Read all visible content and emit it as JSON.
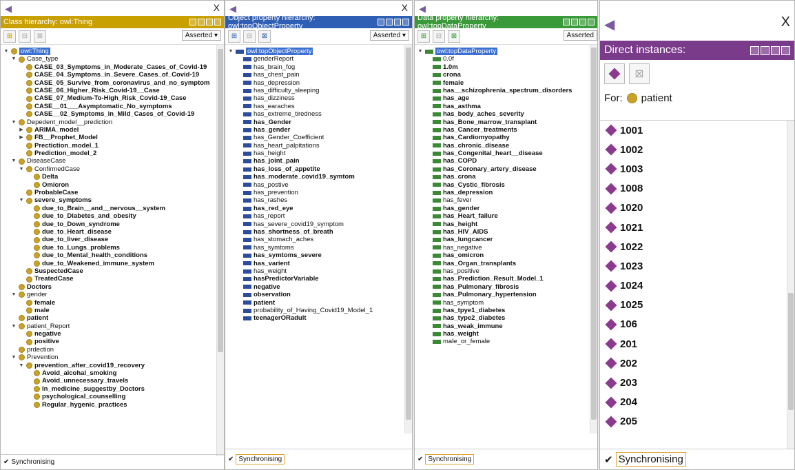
{
  "class_panel": {
    "title": "Class hierarchy: owl:Thing",
    "title_color": "#c8a000",
    "asserted": "Asserted",
    "close": "X",
    "sync": "Synchronising",
    "nodes": [
      {
        "d": 0,
        "t": "owl:Thing",
        "sel": true,
        "tog": "▼"
      },
      {
        "d": 1,
        "t": "Case_type",
        "tog": "▼"
      },
      {
        "d": 2,
        "t": "CASE_03_Symptoms_in_Moderate_Cases_of_Covid-19",
        "b": true
      },
      {
        "d": 2,
        "t": "CASE_04_Symptoms_in_Severe_Cases_of_Covid-19",
        "b": true
      },
      {
        "d": 2,
        "t": "CASE_05_Survive_from_coronavirus_and_no_symptom",
        "b": true
      },
      {
        "d": 2,
        "t": "CASE_06_Higher_Risk_Covid-19__Case",
        "b": true
      },
      {
        "d": 2,
        "t": "CASE_07_Medium-To-High_Risk_Covid-19_Case",
        "b": true
      },
      {
        "d": 2,
        "t": "CASE__01___Asymptomatic_No_symptoms",
        "b": true
      },
      {
        "d": 2,
        "t": "CASE__02_Symptoms_in_Mild_Cases_of_Covid-19",
        "b": true
      },
      {
        "d": 1,
        "t": "Depedent_model__prediction",
        "tog": "▼"
      },
      {
        "d": 2,
        "t": "ARIMA_model",
        "b": true,
        "tog": "▶"
      },
      {
        "d": 2,
        "t": "FB__Prophet_Model",
        "b": true,
        "tog": "▶"
      },
      {
        "d": 2,
        "t": "Prectiction_model_1",
        "b": true
      },
      {
        "d": 2,
        "t": "Prediction_model_2",
        "b": true
      },
      {
        "d": 1,
        "t": "DiseaseCase",
        "tog": "▼"
      },
      {
        "d": 2,
        "t": "ConfirmedCase",
        "tog": "▼"
      },
      {
        "d": 3,
        "t": "Delta",
        "b": true
      },
      {
        "d": 3,
        "t": "Omicron",
        "b": true
      },
      {
        "d": 2,
        "t": "ProbableCase",
        "b": true
      },
      {
        "d": 2,
        "t": "severe_symptoms",
        "b": true,
        "tog": "▼"
      },
      {
        "d": 3,
        "t": "due_to_Brain__and__nervous__system",
        "b": true
      },
      {
        "d": 3,
        "t": "due_to_Diabetes_and_obesity",
        "b": true
      },
      {
        "d": 3,
        "t": "due_to_Down_syndrome",
        "b": true
      },
      {
        "d": 3,
        "t": "due_to_Heart_disease",
        "b": true
      },
      {
        "d": 3,
        "t": "due_to_liver_disease",
        "b": true
      },
      {
        "d": 3,
        "t": "due_to_Lungs_problems",
        "b": true
      },
      {
        "d": 3,
        "t": "due_to_Mental_health_conditions",
        "b": true
      },
      {
        "d": 3,
        "t": "due_to_Weakened_immune_system",
        "b": true
      },
      {
        "d": 2,
        "t": "SuspectedCase",
        "b": true
      },
      {
        "d": 2,
        "t": "TreatedCase",
        "b": true
      },
      {
        "d": 1,
        "t": "Doctors",
        "b": true
      },
      {
        "d": 1,
        "t": "gender",
        "tog": "▼"
      },
      {
        "d": 2,
        "t": "female",
        "b": true
      },
      {
        "d": 2,
        "t": "male",
        "b": true
      },
      {
        "d": 1,
        "t": "patient",
        "b": true
      },
      {
        "d": 1,
        "t": "patient_Report",
        "tog": "▼"
      },
      {
        "d": 2,
        "t": "negative",
        "b": true
      },
      {
        "d": 2,
        "t": "positive",
        "b": true
      },
      {
        "d": 1,
        "t": "prdection"
      },
      {
        "d": 1,
        "t": "Prevention",
        "tog": "▼"
      },
      {
        "d": 2,
        "t": "prevention_after_covid19_recovery",
        "b": true,
        "tog": "▼"
      },
      {
        "d": 3,
        "t": "Avoid_alcohal_smoking",
        "b": true
      },
      {
        "d": 3,
        "t": "Avoid_unnecessary_travels",
        "b": true
      },
      {
        "d": 3,
        "t": "In_medicine_suggestby_Doctors",
        "b": true
      },
      {
        "d": 3,
        "t": "psychological_counselling",
        "b": true
      },
      {
        "d": 3,
        "t": "Regular_hygenic_practices",
        "b": true
      }
    ]
  },
  "object_panel": {
    "title": "Object property hierarchy: owl:topObjectProperty",
    "title_color": "#2f5fb5",
    "asserted": "Asserted",
    "close": "X",
    "sync": "Synchronising",
    "nodes": [
      {
        "d": 0,
        "t": "owl:topObjectProperty",
        "sel": true,
        "tog": "▼"
      },
      {
        "d": 1,
        "t": "genderReport"
      },
      {
        "d": 1,
        "t": "has_brain_fog"
      },
      {
        "d": 1,
        "t": "has_chest_pain"
      },
      {
        "d": 1,
        "t": "has_depression"
      },
      {
        "d": 1,
        "t": "has_difficulty_sleeping"
      },
      {
        "d": 1,
        "t": "has_dizziness"
      },
      {
        "d": 1,
        "t": "has_earaches"
      },
      {
        "d": 1,
        "t": "has_extreme_tiredness"
      },
      {
        "d": 1,
        "t": "has_Gender",
        "b": true
      },
      {
        "d": 1,
        "t": "has_gender",
        "b": true
      },
      {
        "d": 1,
        "t": "has_Gender_Coefficient"
      },
      {
        "d": 1,
        "t": "has_heart_palpitations"
      },
      {
        "d": 1,
        "t": "has_height"
      },
      {
        "d": 1,
        "t": "has_joint_pain",
        "b": true
      },
      {
        "d": 1,
        "t": "has_loss_of_appetite",
        "b": true
      },
      {
        "d": 1,
        "t": "has_moderate_covid19_symtom",
        "b": true
      },
      {
        "d": 1,
        "t": "has_postive"
      },
      {
        "d": 1,
        "t": "has_prevention"
      },
      {
        "d": 1,
        "t": "has_rashes"
      },
      {
        "d": 1,
        "t": "has_red_eye",
        "b": true
      },
      {
        "d": 1,
        "t": "has_report"
      },
      {
        "d": 1,
        "t": "has_severe_covid19_symptom"
      },
      {
        "d": 1,
        "t": "has_shortness_of_breath",
        "b": true
      },
      {
        "d": 1,
        "t": "has_stomach_aches"
      },
      {
        "d": 1,
        "t": "has_symtoms"
      },
      {
        "d": 1,
        "t": "has_symtoms_severe",
        "b": true
      },
      {
        "d": 1,
        "t": "has_varient",
        "b": true
      },
      {
        "d": 1,
        "t": "has_weight"
      },
      {
        "d": 1,
        "t": "hasPredictorVariable",
        "b": true
      },
      {
        "d": 1,
        "t": "negative",
        "b": true
      },
      {
        "d": 1,
        "t": "observation",
        "b": true
      },
      {
        "d": 1,
        "t": "patient",
        "b": true
      },
      {
        "d": 1,
        "t": "probability_of_Having_Covid19_Model_1"
      },
      {
        "d": 1,
        "t": "teenagerORadult",
        "b": true
      }
    ]
  },
  "data_panel": {
    "title": "Data property hierarchy: owl:topDataProperty",
    "title_color": "#3a9a3a",
    "asserted": "Asserted",
    "sync": "Synchronising",
    "nodes": [
      {
        "d": 0,
        "t": "owl:topDataProperty",
        "sel": true,
        "tog": "▼"
      },
      {
        "d": 1,
        "t": "0.0f"
      },
      {
        "d": 1,
        "t": "1.0m",
        "b": true
      },
      {
        "d": 1,
        "t": "crona",
        "b": true
      },
      {
        "d": 1,
        "t": "female",
        "b": true
      },
      {
        "d": 1,
        "t": "has__schizophrenia_spectrum_disorders",
        "b": true
      },
      {
        "d": 1,
        "t": "has_age",
        "b": true
      },
      {
        "d": 1,
        "t": "has_asthma",
        "b": true
      },
      {
        "d": 1,
        "t": "has_body_aches_severity",
        "b": true
      },
      {
        "d": 1,
        "t": "has_Bone_marrow_transplant",
        "b": true
      },
      {
        "d": 1,
        "t": "has_Cancer_treatments",
        "b": true
      },
      {
        "d": 1,
        "t": "has_Cardiomyopathy",
        "b": true
      },
      {
        "d": 1,
        "t": "has_chronic_disease",
        "b": true
      },
      {
        "d": 1,
        "t": "has_Congenital_heart__disease",
        "b": true
      },
      {
        "d": 1,
        "t": "has_COPD",
        "b": true
      },
      {
        "d": 1,
        "t": "has_Coronary_artery_disease",
        "b": true
      },
      {
        "d": 1,
        "t": "has_crona",
        "b": true
      },
      {
        "d": 1,
        "t": "has_Cystic_fibrosis",
        "b": true
      },
      {
        "d": 1,
        "t": "has_depression",
        "b": true
      },
      {
        "d": 1,
        "t": "has_fever"
      },
      {
        "d": 1,
        "t": "has_gender",
        "b": true
      },
      {
        "d": 1,
        "t": "has_Heart_failure",
        "b": true
      },
      {
        "d": 1,
        "t": "has_height",
        "b": true
      },
      {
        "d": 1,
        "t": "has_HIV_AIDS",
        "b": true
      },
      {
        "d": 1,
        "t": "has_lungcancer",
        "b": true
      },
      {
        "d": 1,
        "t": "has_negative"
      },
      {
        "d": 1,
        "t": "has_omicron",
        "b": true
      },
      {
        "d": 1,
        "t": "has_Organ_transplants",
        "b": true
      },
      {
        "d": 1,
        "t": "has_positive"
      },
      {
        "d": 1,
        "t": "has_Prediction_Result_Model_1",
        "b": true
      },
      {
        "d": 1,
        "t": "has_Pulmonary_fibrosis",
        "b": true
      },
      {
        "d": 1,
        "t": "has_Pulmonary_hypertension",
        "b": true
      },
      {
        "d": 1,
        "t": "has_symptom"
      },
      {
        "d": 1,
        "t": "has_tpye1_diabetes",
        "b": true
      },
      {
        "d": 1,
        "t": "has_type2_diabetes",
        "b": true
      },
      {
        "d": 1,
        "t": "has_weak_immune",
        "b": true
      },
      {
        "d": 1,
        "t": "has_weight",
        "b": true
      },
      {
        "d": 1,
        "t": "male_or_female"
      }
    ]
  },
  "instances_panel": {
    "title": "Direct instances:",
    "title_color": "#7b3b8b",
    "close": "X",
    "for_label": "For:",
    "for_class": "patient",
    "sync": "Synchronising",
    "instances": [
      "1001",
      "1002",
      "1003",
      "1008",
      "1020",
      "1021",
      "1022",
      "1023",
      "1024",
      "1025",
      "106",
      "201",
      "202",
      "203",
      "204",
      "205"
    ]
  }
}
